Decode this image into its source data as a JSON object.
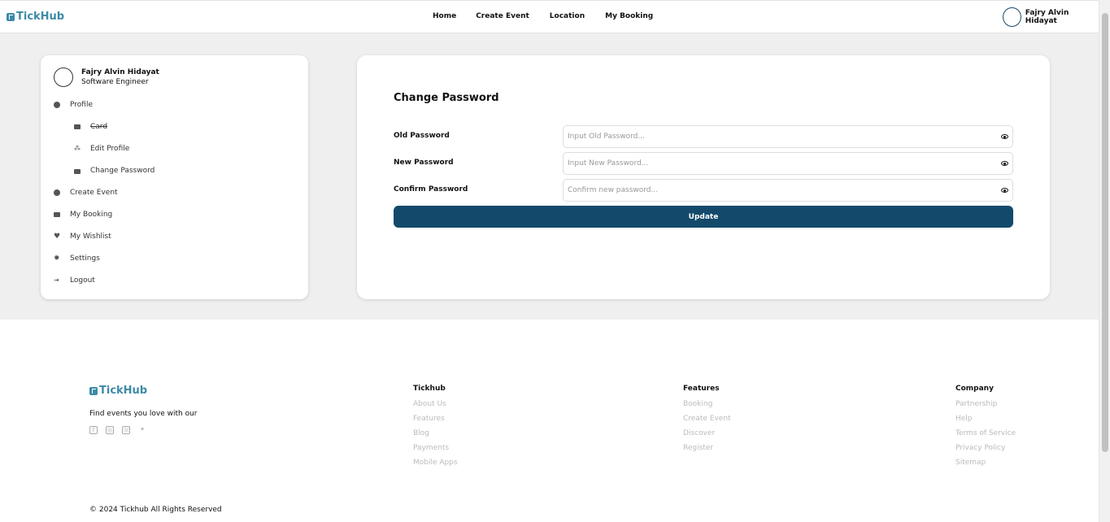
{
  "brand": {
    "name": "TickHub",
    "color": "#3d8aa8"
  },
  "nav": {
    "home": "Home",
    "create_event": "Create Event",
    "location": "Location",
    "my_booking": "My Booking"
  },
  "user": {
    "name": "Fajry Alvin Hidayat",
    "role": "Software Engineer"
  },
  "sidebar": {
    "profile": "Profile",
    "card": "Card",
    "edit_profile": "Edit Profile",
    "change_password": "Change Password",
    "create_event": "Create Event",
    "my_booking": "My Booking",
    "my_wishlist": "My Wishlist",
    "settings": "Settings",
    "logout": "Logout"
  },
  "form": {
    "title": "Change Password",
    "old_label": "Old Password",
    "old_placeholder": "Input Old Password...",
    "new_label": "New Password",
    "new_placeholder": "Input New Password...",
    "confirm_label": "Confirm Password",
    "confirm_placeholder": "Confirm new password...",
    "submit": "Update",
    "button_color": "#134a6b"
  },
  "footer": {
    "tagline": "Find events you love with our",
    "columns": [
      {
        "title": "Tickhub",
        "links": [
          "About Us",
          "Features",
          "Blog",
          "Payments",
          "Mobile Apps"
        ]
      },
      {
        "title": "Features",
        "links": [
          "Booking",
          "Create Event",
          "Discover",
          "Register"
        ]
      },
      {
        "title": "Company",
        "links": [
          "Partnership",
          "Help",
          "Terms of Service",
          "Privacy Policy",
          "Sitemap"
        ]
      }
    ],
    "copyright": "© 2024 Tickhub All Rights Reserved"
  }
}
